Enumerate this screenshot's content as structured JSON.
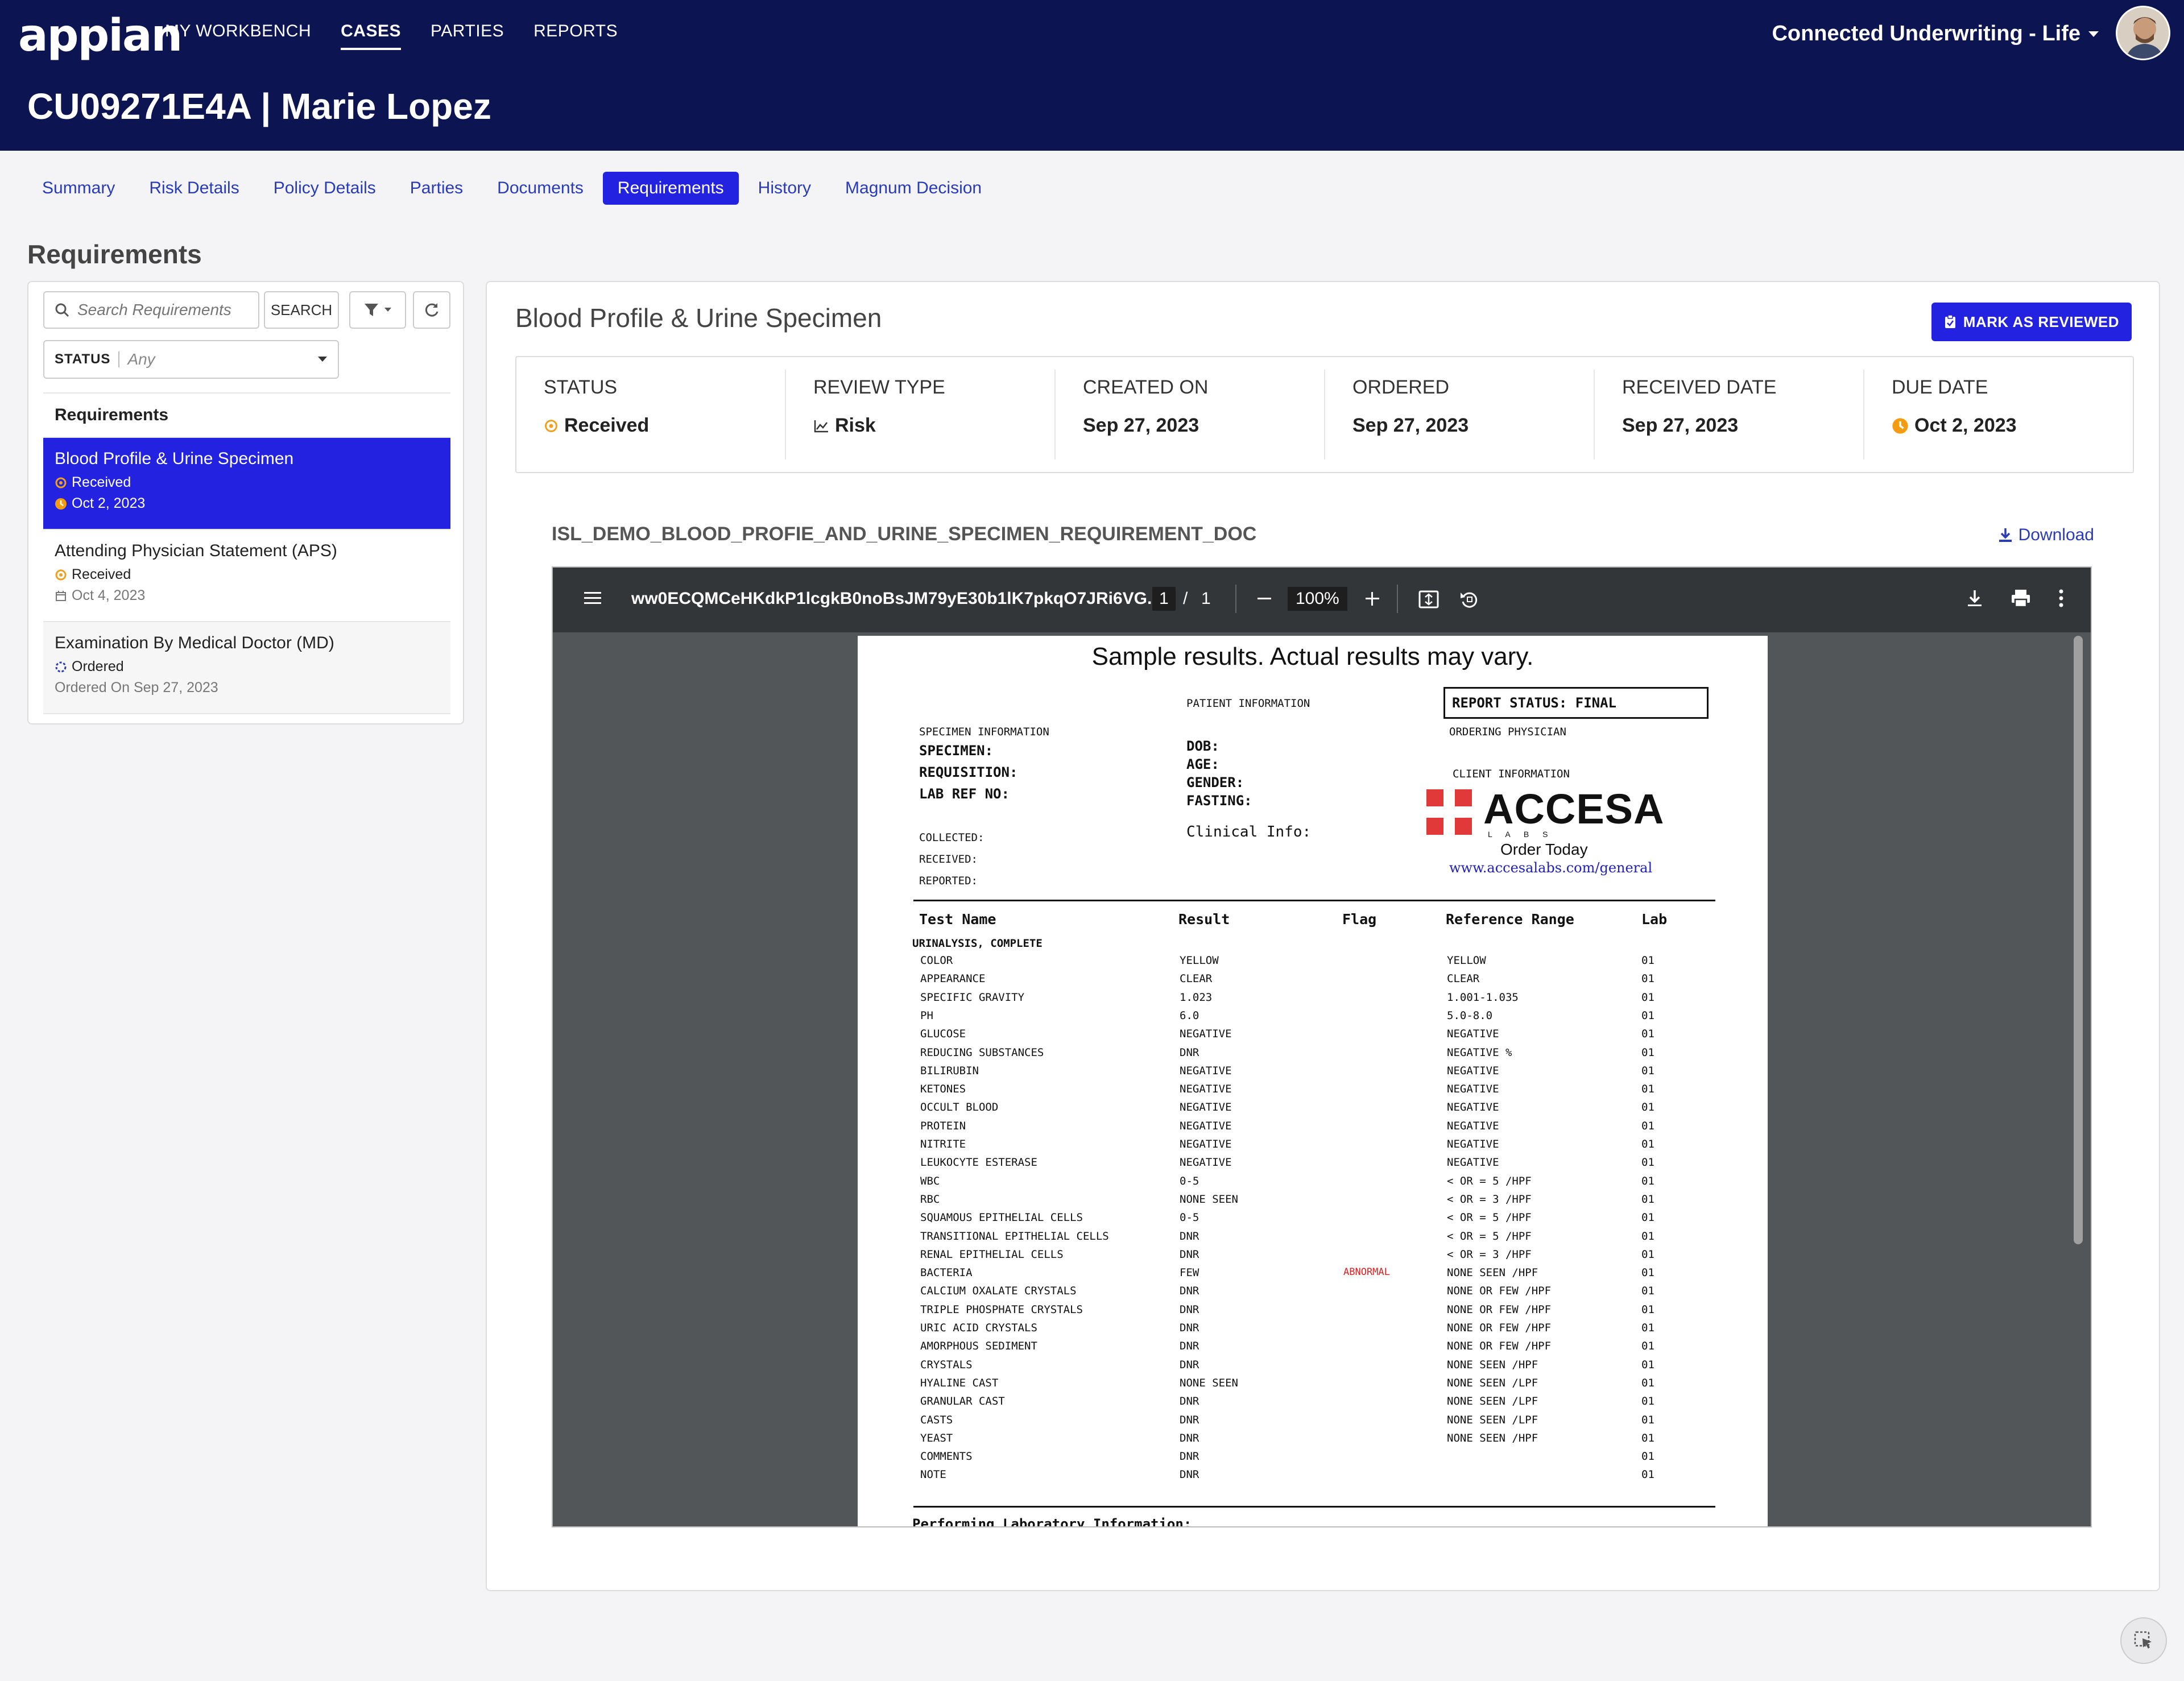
{
  "header": {
    "logo": "appian",
    "nav": [
      "MY WORKBENCH",
      "CASES",
      "PARTIES",
      "REPORTS"
    ],
    "active_nav": 1,
    "app_name": "Connected Underwriting - Life",
    "case_title": "CU09271E4A | Marie Lopez"
  },
  "tabs": [
    "Summary",
    "Risk Details",
    "Policy Details",
    "Parties",
    "Documents",
    "Requirements",
    "History",
    "Magnum Decision"
  ],
  "active_tab": 5,
  "section_title": "Requirements",
  "left": {
    "search_placeholder": "Search Requirements",
    "search_button": "SEARCH",
    "status_label": "STATUS",
    "status_value": "Any",
    "list_header": "Requirements",
    "items": [
      {
        "name": "Blood Profile & Urine Specimen",
        "status": "Received",
        "date": "Oct 2, 2023"
      },
      {
        "name": "Attending Physician Statement (APS)",
        "status": "Received",
        "date": "Oct 4, 2023"
      },
      {
        "name": "Examination By Medical Doctor (MD)",
        "status": "Ordered",
        "date": "Ordered On Sep 27, 2023"
      }
    ]
  },
  "detail": {
    "title": "Blood Profile & Urine Specimen",
    "mark_reviewed": "MARK AS REVIEWED",
    "meta": [
      {
        "label": "STATUS",
        "value": "Received"
      },
      {
        "label": "REVIEW TYPE",
        "value": "Risk"
      },
      {
        "label": "CREATED ON",
        "value": "Sep 27, 2023"
      },
      {
        "label": "ORDERED",
        "value": "Sep 27, 2023"
      },
      {
        "label": "RECEIVED DATE",
        "value": "Sep 27, 2023"
      },
      {
        "label": "DUE DATE",
        "value": "Oct 2, 2023"
      }
    ],
    "doc_name": "ISL_DEMO_BLOOD_PROFIE_AND_URINE_SPECIMEN_REQUIREMENT_DOC",
    "download": "Download"
  },
  "viewer": {
    "file_name": "ww0ECQMCeHKdkP1lcgkB0noBsJM79yE30b1lK7pkqO7JRi6VG...",
    "page_current": "1",
    "page_sep": "/",
    "page_total": "1",
    "zoom": "100%"
  },
  "pdf": {
    "title": "Sample results. Actual results may vary.",
    "patient_info": "PATIENT INFORMATION",
    "report_status": "REPORT STATUS:  FINAL",
    "ordering_physician": "ORDERING PHYSICIAN",
    "specimen_info": "SPECIMEN INFORMATION",
    "specimen_fields": [
      "SPECIMEN:",
      "REQUISITION:",
      "LAB REF NO:"
    ],
    "patient_fields": [
      "DOB:",
      "AGE:",
      "GENDER:",
      "FASTING:"
    ],
    "clinical_info": "Clinical Info:",
    "client_info": "CLIENT INFORMATION",
    "lab_name": "ACCESA",
    "lab_sub": "L  A  B  S",
    "order_today": "Order Today",
    "lab_url": "www.accesalabs.com/general",
    "dates": [
      "COLLECTED:",
      "RECEIVED:",
      "REPORTED:"
    ],
    "columns": [
      "Test Name",
      "Result",
      "Flag",
      "Reference Range",
      "Lab"
    ],
    "group": "URINALYSIS, COMPLETE",
    "rows": [
      [
        "COLOR",
        "YELLOW",
        "",
        "YELLOW",
        "01"
      ],
      [
        "APPEARANCE",
        "CLEAR",
        "",
        "CLEAR",
        "01"
      ],
      [
        "SPECIFIC GRAVITY",
        "1.023",
        "",
        "1.001-1.035",
        "01"
      ],
      [
        "PH",
        "6.0",
        "",
        "5.0-8.0",
        "01"
      ],
      [
        "GLUCOSE",
        "NEGATIVE",
        "",
        "NEGATIVE",
        "01"
      ],
      [
        "REDUCING SUBSTANCES",
        "DNR",
        "",
        "NEGATIVE %",
        "01"
      ],
      [
        "BILIRUBIN",
        "NEGATIVE",
        "",
        "NEGATIVE",
        "01"
      ],
      [
        "KETONES",
        "NEGATIVE",
        "",
        "NEGATIVE",
        "01"
      ],
      [
        "OCCULT BLOOD",
        "NEGATIVE",
        "",
        "NEGATIVE",
        "01"
      ],
      [
        "PROTEIN",
        "NEGATIVE",
        "",
        "NEGATIVE",
        "01"
      ],
      [
        "NITRITE",
        "NEGATIVE",
        "",
        "NEGATIVE",
        "01"
      ],
      [
        "LEUKOCYTE ESTERASE",
        "NEGATIVE",
        "",
        "NEGATIVE",
        "01"
      ],
      [
        "WBC",
        "0-5",
        "",
        "< OR = 5 /HPF",
        "01"
      ],
      [
        "RBC",
        "NONE SEEN",
        "",
        "< OR = 3 /HPF",
        "01"
      ],
      [
        "SQUAMOUS EPITHELIAL CELLS",
        "0-5",
        "",
        "< OR = 5 /HPF",
        "01"
      ],
      [
        "TRANSITIONAL EPITHELIAL CELLS",
        "DNR",
        "",
        "< OR = 5 /HPF",
        "01"
      ],
      [
        "RENAL EPITHELIAL CELLS",
        "DNR",
        "",
        "< OR = 3 /HPF",
        "01"
      ],
      [
        "BACTERIA",
        "FEW",
        "ABNORMAL",
        "NONE SEEN /HPF",
        "01"
      ],
      [
        "CALCIUM OXALATE CRYSTALS",
        "DNR",
        "",
        "NONE OR FEW /HPF",
        "01"
      ],
      [
        "TRIPLE PHOSPHATE CRYSTALS",
        "DNR",
        "",
        "NONE OR FEW /HPF",
        "01"
      ],
      [
        "URIC ACID CRYSTALS",
        "DNR",
        "",
        "NONE OR FEW /HPF",
        "01"
      ],
      [
        "AMORPHOUS SEDIMENT",
        "DNR",
        "",
        "NONE OR FEW /HPF",
        "01"
      ],
      [
        "CRYSTALS",
        "DNR",
        "",
        "NONE SEEN /HPF",
        "01"
      ],
      [
        "HYALINE CAST",
        "NONE SEEN",
        "",
        "NONE SEEN /LPF",
        "01"
      ],
      [
        "GRANULAR CAST",
        "DNR",
        "",
        "NONE SEEN /LPF",
        "01"
      ],
      [
        "CASTS",
        "DNR",
        "",
        "NONE SEEN /LPF",
        "01"
      ],
      [
        "YEAST",
        "DNR",
        "",
        "NONE SEEN /HPF",
        "01"
      ],
      [
        "COMMENTS",
        "DNR",
        "",
        "",
        "01"
      ],
      [
        "NOTE",
        "DNR",
        "",
        "",
        "01"
      ]
    ],
    "footer": "Performing Laboratory Information:"
  },
  "colors": {
    "header_bg": "#0c1452",
    "accent": "#2222e0",
    "link": "#2a3bb8",
    "status_received": "#f0a020",
    "due_warning": "#f39c12",
    "abnormal": "#e02020",
    "lab_red": "#e13939"
  }
}
